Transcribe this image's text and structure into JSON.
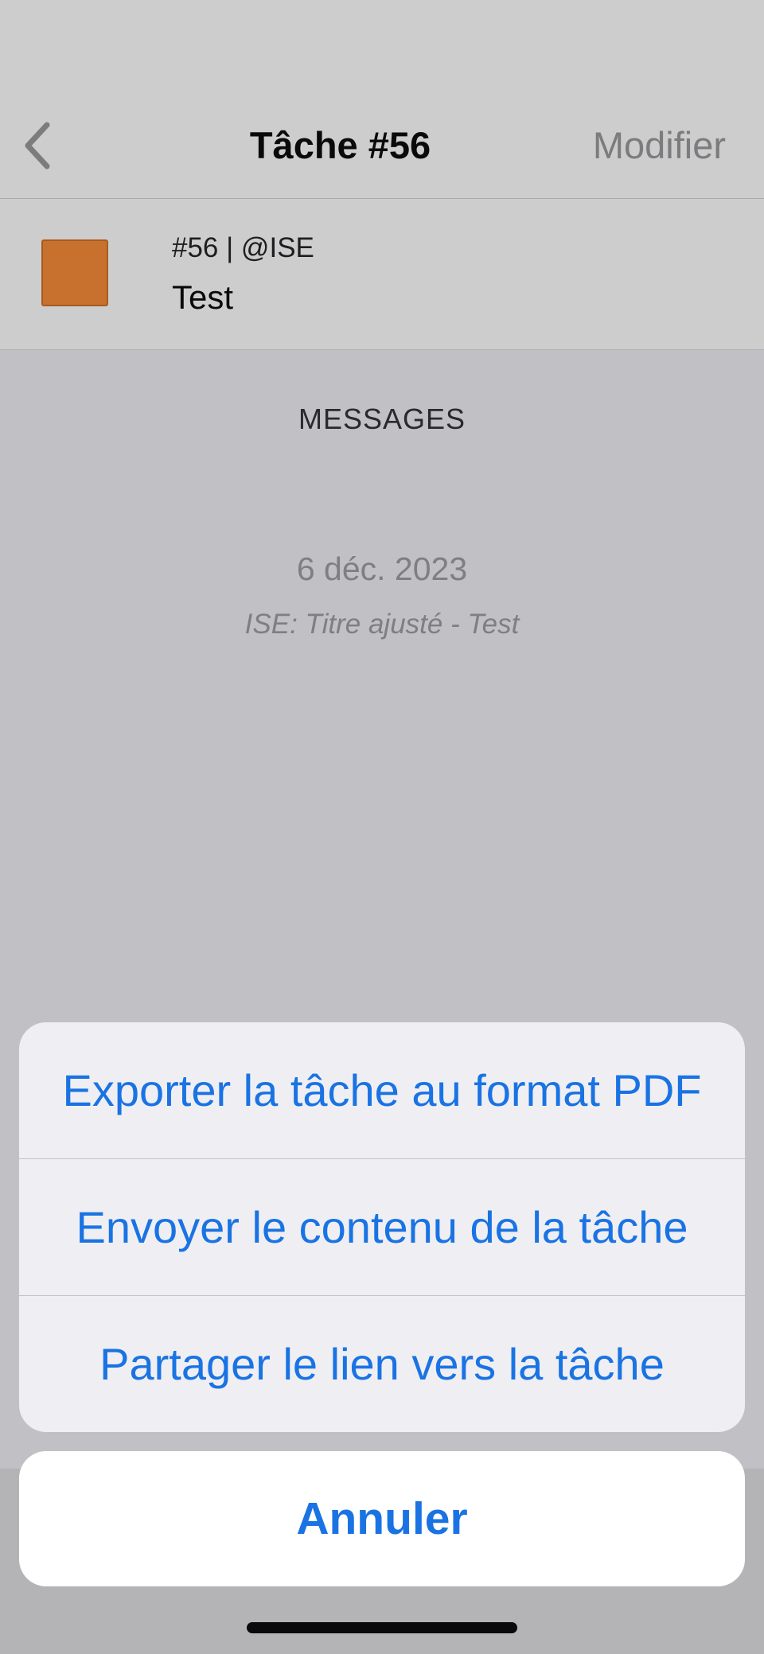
{
  "nav": {
    "back_icon": "chevron-left-icon",
    "title": "Tâche #56",
    "edit_label": "Modifier"
  },
  "task": {
    "color": "#c8702d",
    "meta": "#56 | @ISE",
    "name": "Test"
  },
  "messages": {
    "header": "MESSAGES",
    "items": [
      {
        "date": "6 déc. 2023",
        "text": "ISE: Titre ajusté - Test"
      }
    ]
  },
  "action_sheet": {
    "actions": [
      {
        "label": "Exporter la tâche au format PDF"
      },
      {
        "label": "Envoyer le contenu de la tâche"
      },
      {
        "label": "Partager le lien vers la tâche"
      }
    ],
    "cancel_label": "Annuler"
  },
  "colors": {
    "accent": "#1a73e3"
  }
}
